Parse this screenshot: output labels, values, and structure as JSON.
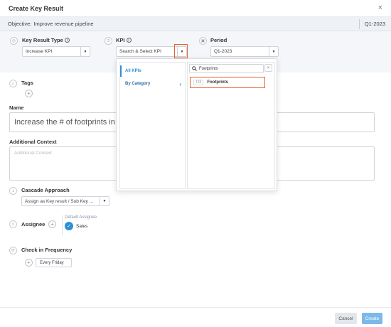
{
  "dialog": {
    "title": "Create Key Result",
    "close_glyph": "×"
  },
  "objective": {
    "label": "Objective:",
    "name": "Improve revenue pipeline",
    "quarter": "Q1-2023"
  },
  "fields": {
    "key_result_type": {
      "label": "Key Result Type",
      "value": "Increase KPI"
    },
    "kpi": {
      "label": "KPI",
      "placeholder": "Search & Select KPI"
    },
    "period": {
      "label": "Period",
      "value": "Q1-2023"
    }
  },
  "tags": {
    "label": "Tags"
  },
  "name": {
    "label": "Name",
    "value": "Increase the # of footprints in th"
  },
  "additional_context": {
    "label": "Additional Context",
    "placeholder": "Additional Context"
  },
  "cascade": {
    "label": "Cascade Approach",
    "value": "Assign as Key result / Sub Key ..."
  },
  "assignee": {
    "label": "Assignee",
    "default_label": "Default Assignee",
    "default_name": "Sales"
  },
  "check_in": {
    "label": "Check in Frequency",
    "value": "Every Friday"
  },
  "kpi_dropdown": {
    "tab_all": "All KPIs",
    "tab_category": "By Category",
    "search_value": "Footprints",
    "results": [
      {
        "count": "133",
        "name": "Footprints"
      }
    ]
  },
  "footer": {
    "cancel": "Cancel",
    "create": "Create"
  },
  "colors": {
    "accent": "#2d8fd5",
    "highlight": "#e8602c",
    "create_button": "#7cb9ea"
  }
}
